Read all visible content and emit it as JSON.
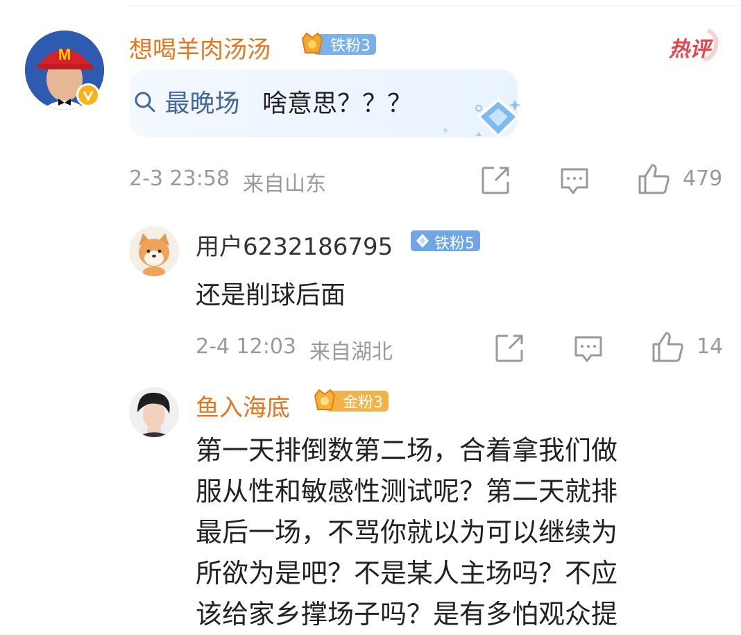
{
  "main_comment": {
    "username": "想喝羊肉汤汤",
    "fan_badge": "铁粉3",
    "hot_label": "热评",
    "link_text": "最晚场",
    "text": "啥意思？？？",
    "timestamp": "2-3 23:58",
    "location": "来自山东",
    "like_count": "479"
  },
  "reply1": {
    "username": "用户6232186795",
    "fan_badge": "铁粉5",
    "text": "还是削球后面",
    "timestamp": "2-4 12:03",
    "location": "来自湖北",
    "like_count": "14"
  },
  "reply2": {
    "username": "鱼入海底",
    "fan_badge": "金粉3",
    "lines": [
      "第一天排倒数第二场，合着拿我们做",
      "服从性和敏感性测试呢？第二天就排",
      "最后一场，不骂你就以为可以继续为",
      "所欲为是吧？不是某人主场吗？不应",
      "该给家乡撑场子吗？是有多怕观众提"
    ]
  },
  "colors": {
    "username_orange": "#e8741c",
    "link_blue": "#44689c",
    "meta_gray": "#9a9a9a",
    "iron_fan_blue": "#6fa7e6",
    "gold_fan": "#f0a33a"
  }
}
